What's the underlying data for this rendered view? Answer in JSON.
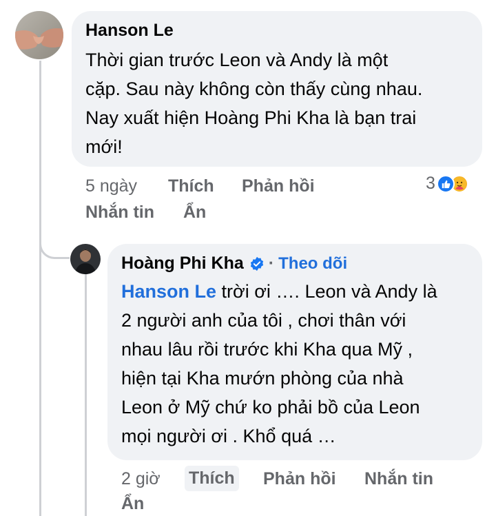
{
  "comment": {
    "author": "Hanson Le",
    "lines": [
      "Thời gian trước Leon và Andy là một",
      "cặp. Sau này không còn thấy cùng nhau.",
      "Nay xuất hiện Hoàng Phi Kha là bạn trai",
      "mới!"
    ],
    "time": "5 ngày",
    "like_label": "Thích",
    "reply_label": "Phản hồi",
    "message_label": "Nhắn tin",
    "hide_label": "Ẩn",
    "reaction_count": "3"
  },
  "reply": {
    "author": "Hoàng Phi Kha",
    "separator": "·",
    "follow_label": "Theo dõi",
    "mention": "Hanson Le",
    "first_line_rest": " trời ơi …. Leon và Andy là",
    "lines": [
      "2 người anh của tôi , chơi thân với",
      "nhau lâu rồi trước khi Kha qua Mỹ ,",
      "hiện tại Kha mướn phòng của nhà",
      "Leon ở Mỹ chứ ko phải bồ của Leon",
      "mọi người ơi . Khổ quá …"
    ],
    "time": "2 giờ",
    "like_label": "Thích",
    "reply_label": "Phản hồi",
    "message_label": "Nhắn tin",
    "hide_label": "Ẩn"
  },
  "colors": {
    "link_blue": "#216fdb",
    "bubble_bg": "#f0f2f5",
    "muted_text": "#65676b"
  },
  "icons": [
    "hands-avatar",
    "profile-avatar",
    "verified-badge-icon",
    "like-reaction-icon",
    "care-reaction-icon"
  ]
}
